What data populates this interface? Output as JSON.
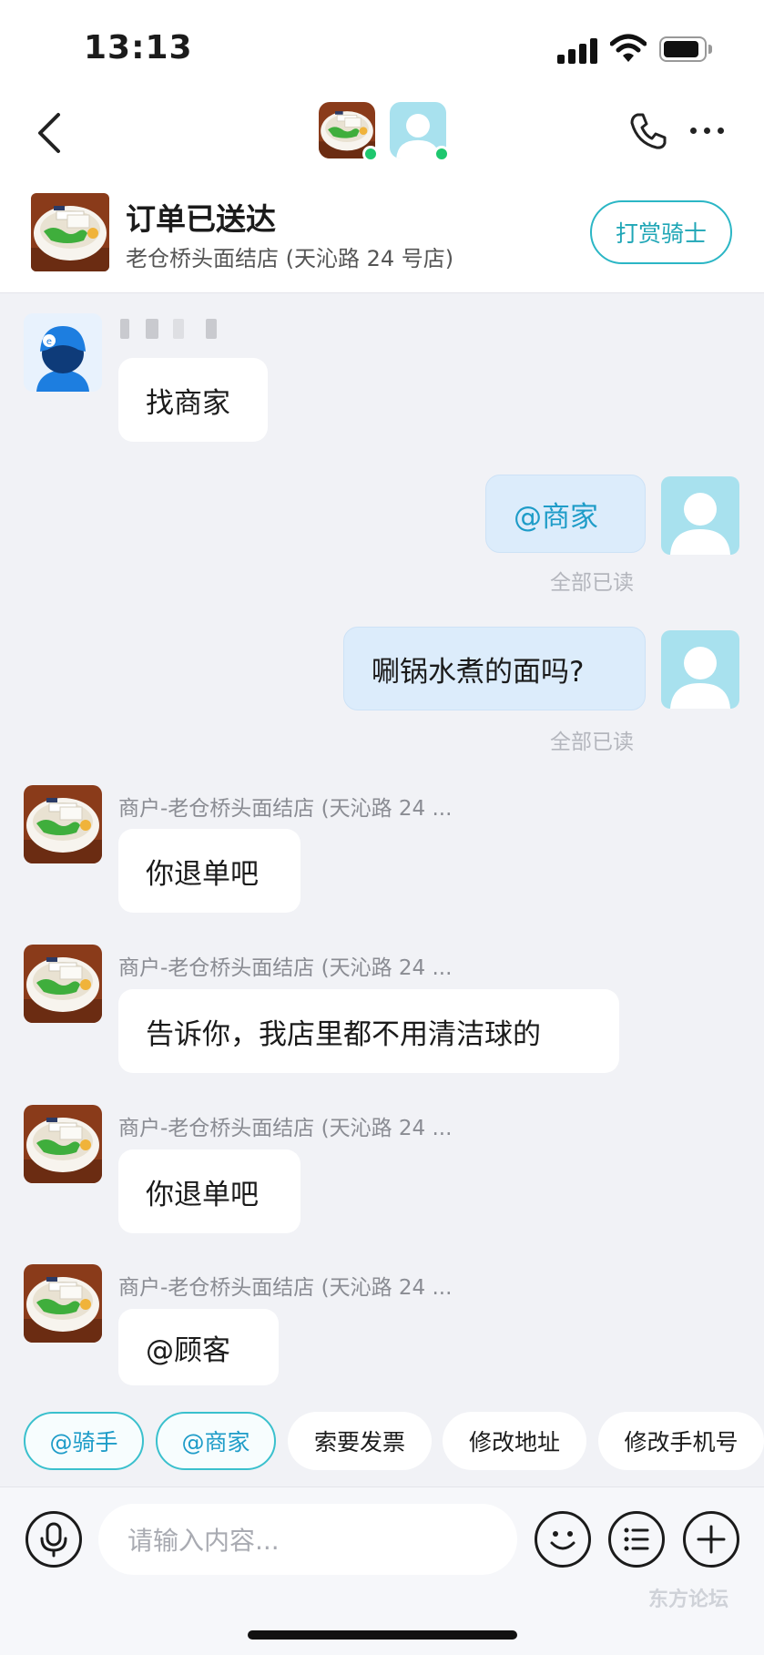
{
  "status_bar": {
    "time": "13:13"
  },
  "order": {
    "title": "订单已送达",
    "store": "老仓桥头面结店 (天沁路 24 号店)",
    "tip_button": "打赏骑士"
  },
  "messages": [
    {
      "sender": "rider",
      "text": "找商家"
    },
    {
      "sender": "me",
      "text": "@商家",
      "read": "全部已读"
    },
    {
      "sender": "me",
      "text": "唰锅水煮的面吗?",
      "read": "全部已读"
    },
    {
      "sender": "merchant",
      "name": "商户-老仓桥头面结店 (天沁路 24 ...",
      "text": "你退单吧"
    },
    {
      "sender": "merchant",
      "name": "商户-老仓桥头面结店 (天沁路 24 ...",
      "text": "告诉你，我店里都不用清洁球的"
    },
    {
      "sender": "merchant",
      "name": "商户-老仓桥头面结店 (天沁路 24 ...",
      "text": "你退单吧"
    },
    {
      "sender": "merchant",
      "name": "商户-老仓桥头面结店 (天沁路 24 ...",
      "text": "@顾客"
    }
  ],
  "quick_chips": [
    "@骑手",
    "@商家",
    "索要发票",
    "修改地址",
    "修改手机号"
  ],
  "input": {
    "placeholder": "请输入内容..."
  },
  "watermark": "东方论坛",
  "colors": {
    "accent": "#1fa6b6",
    "online": "#1ec76e",
    "outgoing_bubble": "#dcecfb"
  }
}
